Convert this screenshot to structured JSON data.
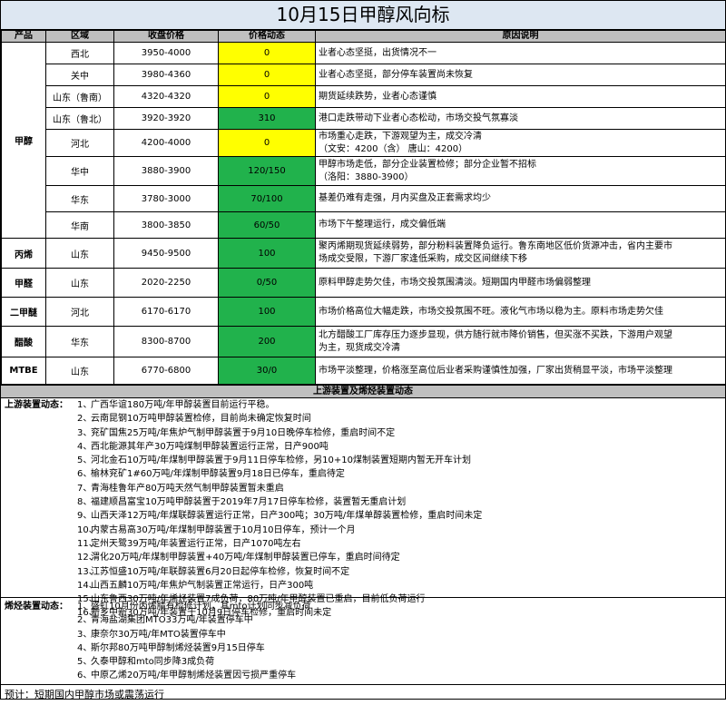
{
  "title": "10月15日甲醇风向标",
  "headers": [
    "产品",
    "区域",
    "收盘价格",
    "价格动态",
    "原因说明"
  ],
  "rows": [
    {
      "product": "甲醇",
      "region": "西北",
      "price": "3950-4000",
      "change": "0",
      "color": "yellow",
      "reason": [
        "业者心态坚挺，出货情况不一"
      ]
    },
    {
      "product": "",
      "region": "关中",
      "price": "3980-4360",
      "change": "0",
      "color": "yellow",
      "reason": [
        "业者心态坚挺，部分停车装置尚未恢复"
      ]
    },
    {
      "product": "",
      "region": "山东（鲁南）",
      "price": "4320-4320",
      "change": "0",
      "color": "yellow",
      "reason": [
        "期货延续跌势，业者心态谨慎"
      ]
    },
    {
      "product": "",
      "region": "山东（鲁北）",
      "price": "3920-3920",
      "change": "310",
      "color": "green",
      "reason": [
        "港口走跌带动下业者心态松动，市场交投气氛寡淡"
      ]
    },
    {
      "product": "",
      "region": "河北",
      "price": "4200-4000",
      "change": "0",
      "color": "yellow",
      "reason": [
        "市场重心走跌，下游观望为主，成交冷清",
        "（文安：4200（含）  唐山：4200）"
      ]
    },
    {
      "product": "",
      "region": "华中",
      "price": "3880-3900",
      "change": "120/150",
      "color": "green",
      "reason": [
        "甲醇市场走低，部分企业装置检修；部分企业暂不招标",
        "（洛阳：3880-3900）"
      ]
    },
    {
      "product": "",
      "region": "华东",
      "price": "3780-3000",
      "change": "70/100",
      "color": "green",
      "reason": [
        "基差仍难有走强，月内买盘及正套需求均少"
      ]
    },
    {
      "product": "",
      "region": "华南",
      "price": "3800-3850",
      "change": "60/50",
      "color": "green",
      "reason": [
        "市场下午整理运行，成交偏低端"
      ]
    },
    {
      "product": "丙烯",
      "region": "山东",
      "price": "9450-9500",
      "change": "100",
      "color": "green",
      "reason": [
        "聚丙烯期现货延续弱势，部分粉料装置降负运行。鲁东南地区低价货源冲击，省内主要市",
        "场成交受限，下游厂家逢低采购，成交区间继续下移"
      ]
    },
    {
      "product": "甲醛",
      "region": "山东",
      "price": "2020-2250",
      "change": "0/50",
      "color": "green",
      "reason": [
        "原料甲醇走势欠佳，市场交投氛围清淡。短期国内甲醛市场偏弱整理"
      ]
    },
    {
      "product": "二甲醚",
      "region": "河北",
      "price": "6170-6170",
      "change": "100",
      "color": "green",
      "reason": [
        "市场价格高位大幅走跌，市场交投氛围不旺。液化气市场以稳为主。原料市场走势欠佳"
      ]
    },
    {
      "product": "醋酸",
      "region": "华东",
      "price": "8300-8700",
      "change": "200",
      "color": "green",
      "reason": [
        "北方醋酸工厂库存压力逐步显现，供方随行就市降价销售，但买涨不买跌，下游用户观望",
        "为主，现货成交冷清"
      ]
    },
    {
      "product": "MTBE",
      "region": "山东",
      "price": "6770-6800",
      "change": "30/0",
      "color": "green",
      "reason": [
        "市场平淡整理，价格涨至高位后业者采购谨慎性加强，厂家出货稍显平淡，市场平淡整理"
      ]
    }
  ],
  "section_title": "上游装置及烯烃装置动态",
  "upstream": {
    "label": "上游装置动态：",
    "items": [
      "广西华谊180万吨/年甲醇装置目前运行平稳。",
      "云南昆钢10万吨甲醇装置检修，目前尚未确定恢复时间",
      "兖矿国焦25万吨/年焦炉气制甲醇装置于9月10日晚停车检修，重启时间不定",
      "西北能源其年产30万吨煤制甲醇装置运行正常，日产900吨",
      "河北金石10万吨/年煤制甲醇装置于9月11日停车检修，另10+10煤制装置短期内暂无开车计划",
      "榆林兖矿1#60万吨/年煤制甲醇装置9月18日已停车，重启待定",
      "青海桂鲁年产80万吨天然气制甲醇装置暂未重启",
      "福建顺昌富宝10万吨甲醇装置于2019年7月17日停车检修，装置暂无重启计划",
      "山西天泽12万吨/年煤联醇装置运行正常，日产300吨；30万吨/年煤单醇装置检修，重启时间未定",
      "内蒙古易高30万吨/年煤制甲醇装置于10月10日停车，预计一个月",
      "定州天鹭39万吨/年装置运行正常，日产1070吨左右",
      "渭化20万吨/年煤制甲醇装置+40万吨/年煤制甲醇装置已停车，重启时间待定",
      "江苏恒盛10万吨/年联醇装置6月20日起停车检修，恢复时间不定",
      "山西五麟10万吨/年焦炉气制装置正常运行，日产300吨",
      "山东鲁西30万吨/年烯烃装置7成负荷，80万吨/年甲醇装置已重启，目前低负荷运行",
      "新乡中新30万吨/年装置于10月9日停车检修，重启时间未定"
    ]
  },
  "olefin": {
    "label": "烯烃装置动态：",
    "items": [
      "盛虹10月份丙烯腈有检修计划，其mto计划同步减负荷",
      "青海盐湖集团MTO33万吨/年装置停车中",
      "康奈尔30万吨/年MTO装置停车中",
      "斯尔邦80万吨甲醇制烯烃装置9月15日停车",
      "久泰甲醇和mto同步降3成负荷",
      "中原乙烯20万吨/年甲醇制烯烃装置因亏损严重停车"
    ]
  },
  "forecast": "预计：短期国内甲醇市场或震荡运行"
}
